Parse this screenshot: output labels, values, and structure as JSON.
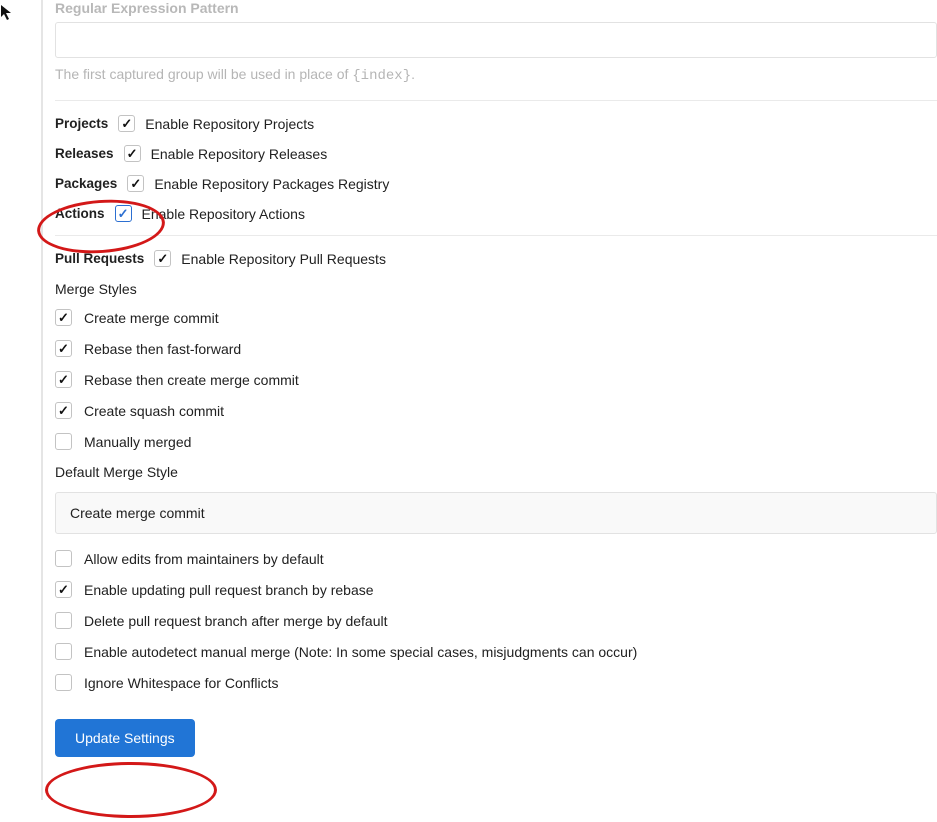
{
  "external_tracker": {
    "label": "Regular Expression Pattern",
    "value": "",
    "help_prefix": "The first captured group will be used in place of ",
    "help_code": "{index}",
    "help_suffix": "."
  },
  "features": {
    "projects": {
      "label": "Projects",
      "check_label": "Enable Repository Projects",
      "checked": true
    },
    "releases": {
      "label": "Releases",
      "check_label": "Enable Repository Releases",
      "checked": true
    },
    "packages": {
      "label": "Packages",
      "check_label": "Enable Repository Packages Registry",
      "checked": true
    },
    "actions": {
      "label": "Actions",
      "check_label": "Enable Repository Actions",
      "checked": true
    },
    "pulls": {
      "label": "Pull Requests",
      "check_label": "Enable Repository Pull Requests",
      "checked": true
    }
  },
  "merge_styles": {
    "heading": "Merge Styles",
    "items": [
      {
        "label": "Create merge commit",
        "checked": true
      },
      {
        "label": "Rebase then fast-forward",
        "checked": true
      },
      {
        "label": "Rebase then create merge commit",
        "checked": true
      },
      {
        "label": "Create squash commit",
        "checked": true
      },
      {
        "label": "Manually merged",
        "checked": false
      }
    ]
  },
  "default_merge_style": {
    "label": "Default Merge Style",
    "selected": "Create merge commit"
  },
  "pr_options": [
    {
      "label": "Allow edits from maintainers by default",
      "checked": false
    },
    {
      "label": "Enable updating pull request branch by rebase",
      "checked": true
    },
    {
      "label": "Delete pull request branch after merge by default",
      "checked": false
    },
    {
      "label": "Enable autodetect manual merge (Note: In some special cases, misjudgments can occur)",
      "checked": false
    },
    {
      "label": "Ignore Whitespace for Conflicts",
      "checked": false
    }
  ],
  "buttons": {
    "update": "Update Settings"
  }
}
